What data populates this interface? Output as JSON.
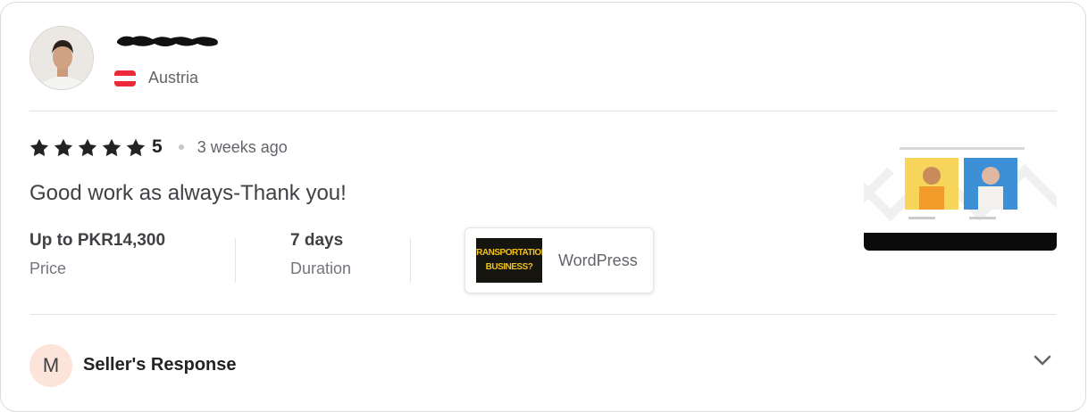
{
  "reviewer": {
    "country": "Austria"
  },
  "review": {
    "rating_value": "5",
    "stars": 5,
    "time_ago": "3 weeks ago",
    "text": "Good work as always-Thank you!"
  },
  "meta": {
    "price_value": "Up to PKR14,300",
    "price_label": "Price",
    "duration_value": "7 days",
    "duration_label": "Duration"
  },
  "gig": {
    "thumb_line1": "TRANSPORTATION",
    "thumb_line2": "BUSINESS?",
    "label": "WordPress"
  },
  "seller_response": {
    "initial": "M",
    "label": "Seller's Response"
  },
  "colors": {
    "star": "#222325",
    "flag_red": "#ed2939",
    "seller_avatar_bg": "#fde4da"
  }
}
